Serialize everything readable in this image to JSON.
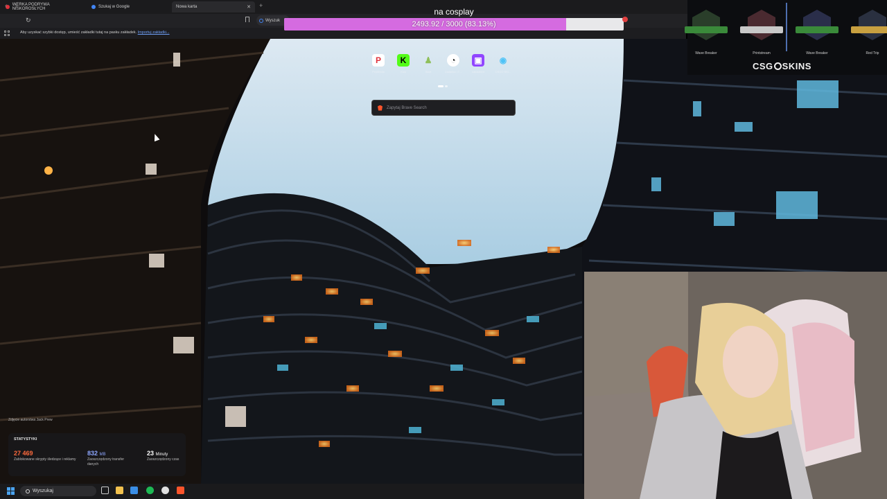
{
  "browser": {
    "tabs": [
      {
        "title": "WERKA PODRYWA NISKOROSŁYCH",
        "favicon_color": "#e0303a",
        "active": false
      },
      {
        "title": "Szukaj w Google",
        "favicon_color": "#4285f4",
        "active": false
      },
      {
        "title": "Nowa karta",
        "favicon_color": "",
        "active": true
      }
    ],
    "new_tab_icon": "plus-icon",
    "omnibox_text": "Wyszuk",
    "bookmarks_bar": {
      "text": "Aby uzyskać szybki dostęp, umieść zakładki tutaj na pasku zakładek.",
      "link": "Importuj zakładki..."
    }
  },
  "new_tab": {
    "shortcuts": [
      {
        "label": "PeyMedia",
        "icon": "P",
        "bg": "#ffffff",
        "fg": "#e0303a"
      },
      {
        "label": "Kick",
        "icon": "K",
        "bg": "#53fc18",
        "fg": "#000000"
      },
      {
        "label": "Start",
        "icon": "♟",
        "bg": "transparent",
        "fg": "#8fbf5a"
      },
      {
        "label": "Zadanka i T...",
        "icon": "◔",
        "bg": "#ffffff",
        "fg": "#222222"
      },
      {
        "label": "cakaclient",
        "icon": "▣",
        "bg": "#9146ff",
        "fg": "#ffffff"
      },
      {
        "label": "CSGO SKI...",
        "icon": "◉",
        "bg": "transparent",
        "fg": "#4fc3f7"
      }
    ],
    "search_placeholder": "Zapytaj Brave Search",
    "photo_credit": "Zdjęcie autorstwa Jack Prew",
    "stats": {
      "title": "STATYSTYKI",
      "items": [
        {
          "value": "27 469",
          "unit": "",
          "label": "Zablokowane skrypty śledzące i reklamy",
          "color": "#ff6a3d"
        },
        {
          "value": "832",
          "unit": "MB",
          "label": "Zaoszczędzony transfer danych",
          "color": "#8ea7ff"
        },
        {
          "value": "23",
          "unit": "Minuty",
          "label": "Zaoszczędzony czas",
          "color": "#ffffff"
        }
      ]
    }
  },
  "overlay": {
    "goal_title": "na cosplay",
    "goal_text": "2493.92 / 3000 (83.13%)",
    "goal_fraction": 0.8313,
    "goal_fill_color": "#d56be0"
  },
  "skins_panel": {
    "brand": "CSGOSKINS",
    "brand_prefix": "CSG",
    "brand_suffix": "SKINS",
    "items": [
      {
        "name": "Wave Breaker",
        "color": "#3a8a3a"
      },
      {
        "name": "Printstream",
        "color": "#c8c8c8"
      },
      {
        "name": "Wave Breaker",
        "color": "#3a8a3a"
      },
      {
        "name": "Red Trip",
        "color": "#c8a040"
      }
    ]
  },
  "taskbar": {
    "search_label": "Wyszukaj",
    "icons": [
      {
        "name": "task-view-icon",
        "color": "#cfcfcf"
      },
      {
        "name": "file-explorer-icon",
        "color": "#f2c14e"
      },
      {
        "name": "store-icon",
        "color": "#3a8ee6"
      },
      {
        "name": "spotify-icon",
        "color": "#1db954"
      },
      {
        "name": "chrome-icon",
        "color": "#e0e0e0"
      },
      {
        "name": "brave-icon",
        "color": "#fb542b"
      }
    ]
  }
}
